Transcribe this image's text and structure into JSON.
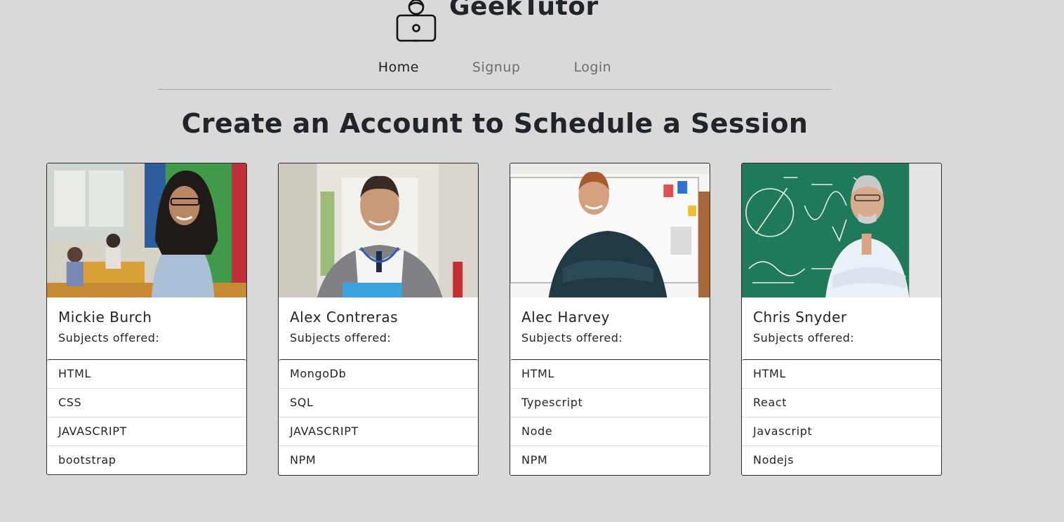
{
  "brand": {
    "title": "GeekTutor",
    "logo_icon": "laptop-user-icon"
  },
  "nav": {
    "items": [
      {
        "label": "Home",
        "active": true
      },
      {
        "label": "Signup",
        "active": false
      },
      {
        "label": "Login",
        "active": false
      }
    ]
  },
  "headline": "Create an Account to Schedule a Session",
  "tutors": [
    {
      "name": "Mickie Burch",
      "subjects_label": "Subjects offered:",
      "subjects": [
        "HTML",
        "CSS",
        "JAVASCRIPT",
        "bootstrap"
      ],
      "photo": "photo-woman-classroom"
    },
    {
      "name": "Alex Contreras",
      "subjects_label": "Subjects offered:",
      "subjects": [
        "MongoDb",
        "SQL",
        "JAVASCRIPT",
        "NPM"
      ],
      "photo": "photo-man-hallway"
    },
    {
      "name": "Alec Harvey",
      "subjects_label": "Subjects offered:",
      "subjects": [
        "HTML",
        "Typescript",
        "Node",
        "NPM"
      ],
      "photo": "photo-man-whiteboard"
    },
    {
      "name": "Chris Snyder",
      "subjects_label": "Subjects offered:",
      "subjects": [
        "HTML",
        "React",
        "Javascript",
        "Nodejs"
      ],
      "photo": "photo-man-chalkboard"
    }
  ]
}
